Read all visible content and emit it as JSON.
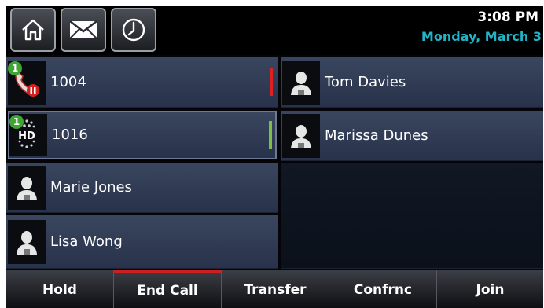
{
  "status": {
    "time": "3:08 PM",
    "date": "Monday, March 3"
  },
  "top_buttons": [
    {
      "icon": "home-icon"
    },
    {
      "icon": "mail-icon"
    },
    {
      "icon": "clock-icon"
    }
  ],
  "lines": [
    {
      "label": "1004",
      "badge": "1",
      "icon": "held-call-icon",
      "status_color": "#e02020"
    },
    {
      "label": "1016",
      "badge": "1",
      "icon": "hd-call-icon",
      "status_color": "#7ac143"
    },
    {
      "label": "Marie Jones",
      "icon": "contact-icon"
    },
    {
      "label": "Lisa Wong",
      "icon": "contact-icon"
    },
    {
      "label": "Tom Davies",
      "icon": "contact-icon"
    },
    {
      "label": "Marissa Dunes",
      "icon": "contact-icon"
    }
  ],
  "softkeys": [
    {
      "label": "Hold"
    },
    {
      "label": "End Call"
    },
    {
      "label": "Transfer"
    },
    {
      "label": "Confrnc"
    },
    {
      "label": "Join"
    }
  ],
  "colors": {
    "date": "#21b3c6",
    "active_softkey": "#cc1f1f",
    "badge": "#3fa535"
  }
}
